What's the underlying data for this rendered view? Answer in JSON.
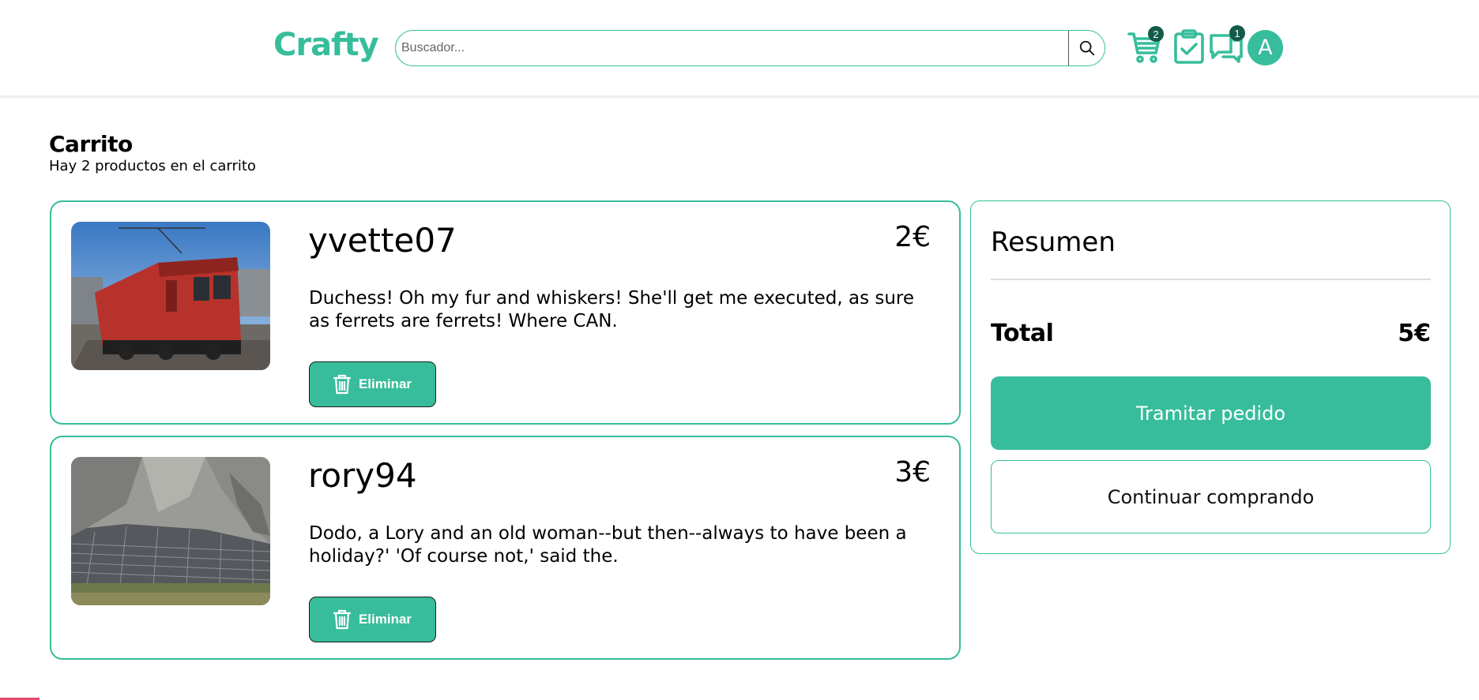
{
  "header": {
    "logo_text": "Crafty",
    "search": {
      "placeholder": "Buscador...",
      "value": ""
    },
    "icons": {
      "cart": {
        "icon": "cart-icon",
        "badge": "2"
      },
      "orders": {
        "icon": "clipboard-check-icon"
      },
      "messages": {
        "icon": "chat-bubbles-icon",
        "badge": "1"
      }
    },
    "avatar_initial": "A"
  },
  "page": {
    "title": "Carrito",
    "subtitle": "Hay 2 productos en el carrito"
  },
  "cart_items": [
    {
      "title": "yvette07",
      "price": "2€",
      "description": "Duchess! Oh my fur and whiskers! She'll get me executed, as sure as ferrets are ferrets! Where CAN.",
      "remove_label": "Eliminar",
      "image": "red-locomotive-photo"
    },
    {
      "title": "rory94",
      "price": "3€",
      "description": "Dodo, a Lory and an old woman--but then--always to have been a holiday?' 'Of course not,' said the.",
      "remove_label": "Eliminar",
      "image": "solar-panels-cliff-photo"
    }
  ],
  "summary": {
    "title": "Resumen",
    "total_label": "Total",
    "total_value": "5€",
    "checkout_label": "Tramitar pedido",
    "continue_label": "Continuar comprando"
  },
  "colors": {
    "accent": "#37bd9b",
    "badge": "#125a4a",
    "divider": "#dcdcdc"
  }
}
